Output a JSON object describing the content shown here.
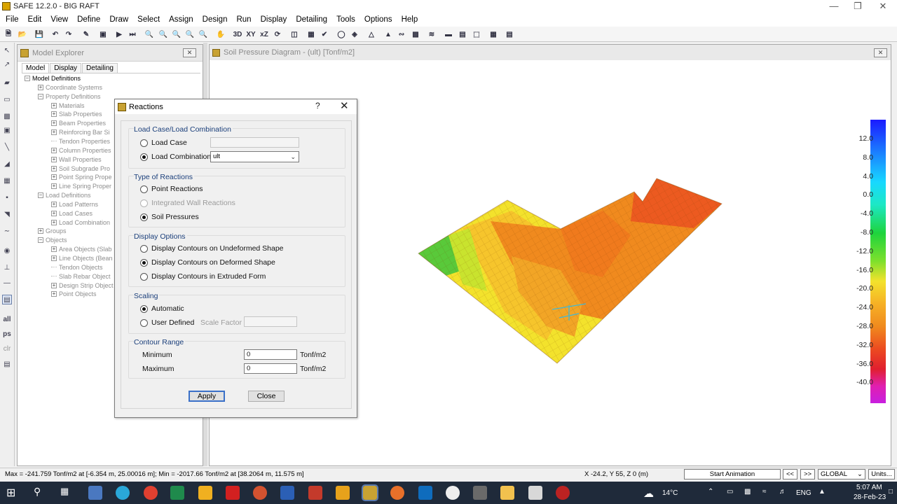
{
  "app": {
    "title": "SAFE 12.2.0 - BIG RAFT"
  },
  "menu": [
    "File",
    "Edit",
    "View",
    "Define",
    "Draw",
    "Select",
    "Assign",
    "Design",
    "Run",
    "Display",
    "Detailing",
    "Tools",
    "Options",
    "Help"
  ],
  "toolbar_text": {
    "t3d": "3D",
    "txy": "XY",
    "txz": "xZ"
  },
  "left_tools": {
    "all": "all",
    "ps": "ps",
    "clr": "clr"
  },
  "explorer": {
    "title": "Model Explorer",
    "tabs": [
      "Model",
      "Display",
      "Detailing"
    ],
    "tree": [
      "Model Definitions",
      "Coordinate Systems",
      "Property Definitions",
      "Materials",
      "Slab Properties",
      "Beam Properties",
      "Reinforcing Bar Si",
      "Tendon Properties",
      "Column Properties",
      "Wall Properties",
      "Soil Subgrade Pro",
      "Point Spring Prope",
      "Line Spring Proper",
      "Load Definitions",
      "Load Patterns",
      "Load Cases",
      "Load Combination",
      "Groups",
      "Objects",
      "Area Objects (Slab",
      "Line Objects (Bean",
      "Tendon Objects",
      "Slab Rebar Object",
      "Design Strip Object",
      "Point Objects"
    ]
  },
  "view": {
    "title": "Soil Pressure Diagram - (ult)  [Tonf/m2]"
  },
  "legend": {
    "labels": [
      "12.0",
      "8.0",
      "4.0",
      "0.0",
      "-4.0",
      "-8.0",
      "-12.0",
      "-16.0",
      "-20.0",
      "-24.0",
      "-28.0",
      "-32.0",
      "-36.0",
      "-40.0"
    ]
  },
  "dialog": {
    "title": "Reactions",
    "help": "?",
    "load_group_label": "Load Case/Load Combination",
    "load_case": "Load Case",
    "load_combination": "Load Combination",
    "combination_value": "ult",
    "reactions_group_label": "Type of Reactions",
    "point_reactions": "Point Reactions",
    "integrated_wall": "Integrated Wall Reactions",
    "soil_pressures": "Soil Pressures",
    "display_group_label": "Display Options",
    "undeformed": "Display Contours on Undeformed Shape",
    "deformed": "Display Contours on Deformed Shape",
    "extruded": "Display Contours in Extruded Form",
    "scaling_group_label": "Scaling",
    "automatic": "Automatic",
    "user_defined": "User Defined",
    "scale_factor": "Scale Factor",
    "contour_group_label": "Contour Range",
    "minimum": "Minimum",
    "maximum": "Maximum",
    "min_value": "0",
    "max_value": "0",
    "unit": "Tonf/m2",
    "apply": "Apply",
    "close": "Close"
  },
  "status": {
    "maxmin": "Max = -241.759 Tonf/m2 at [-6.354 m, 25.00016 m];  Min = -2017.66 Tonf/m2 at [38.2064 m, 11.575 m]",
    "coords": "X -24.2,  Y 55,  Z 0  (m)",
    "animation": "Start Animation",
    "prev": "<<",
    "next": ">>",
    "coordsys": "GLOBAL",
    "units": "Units..."
  },
  "taskbar": {
    "temp": "14°C",
    "lang": "ENG",
    "time": "5:07 AM",
    "date": "28-Feb-23"
  },
  "colors": {
    "contour_orange": "#f08a1e",
    "contour_yellow": "#f3e22c",
    "contour_green": "#59c93a",
    "contour_red": "#ec4a20"
  }
}
